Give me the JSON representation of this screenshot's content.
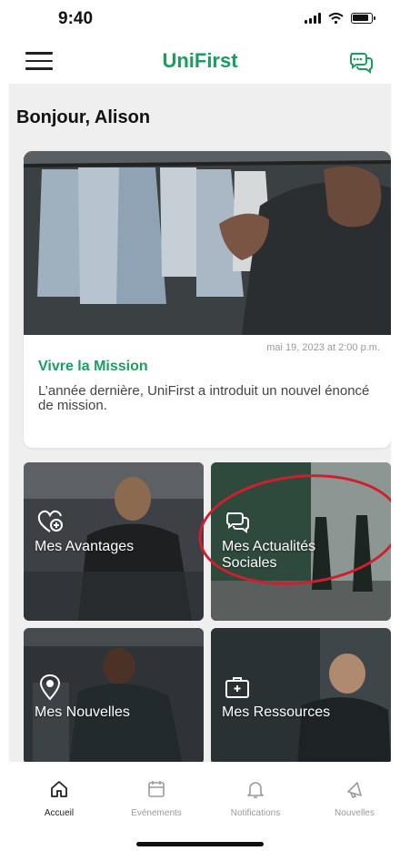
{
  "status_bar": {
    "time": "9:40"
  },
  "header": {
    "title": "UniFirst"
  },
  "greeting": "Bonjour, Alison",
  "feature": {
    "date": "mai 19, 2023 at 2:00 p.m.",
    "title": "Vivre la Mission",
    "description": "L’année dernière, UniFirst a introduit un nouvel énoncé de mission."
  },
  "tiles": [
    {
      "label": "Mes Avantages",
      "icon": "heart-plus-icon"
    },
    {
      "label": "Mes Actualités Sociales",
      "icon": "chat-icon"
    },
    {
      "label": "Mes Nouvelles",
      "icon": "location-pin-icon"
    },
    {
      "label": "Mes Ressources",
      "icon": "briefcase-icon"
    }
  ],
  "tabs": [
    {
      "label": "Accueil",
      "icon": "home-icon",
      "active": true
    },
    {
      "label": "Evénements",
      "icon": "calendar-icon",
      "active": false
    },
    {
      "label": "Notifications",
      "icon": "bell-icon",
      "active": false
    },
    {
      "label": "Nouvelles",
      "icon": "megaphone-icon",
      "active": false
    }
  ],
  "colors": {
    "brand": "#1a9e5f",
    "annotation": "#d11e2e"
  }
}
